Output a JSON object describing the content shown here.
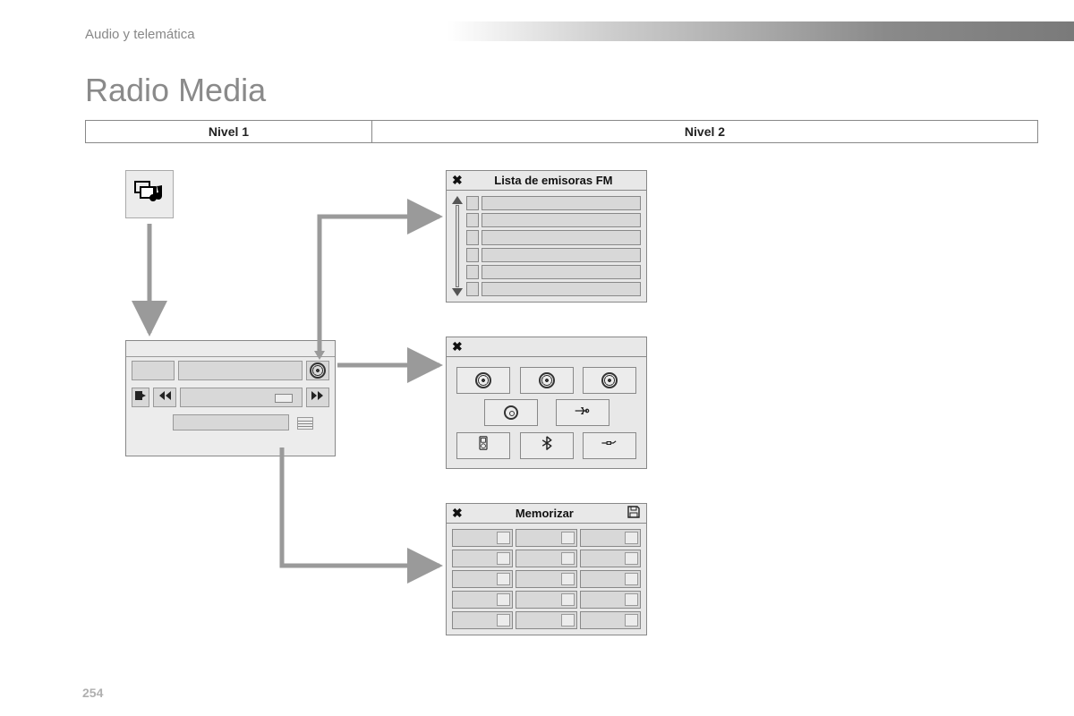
{
  "breadcrumb": "Audio y telemática",
  "title": "Radio Media",
  "page_number": "254",
  "levels": {
    "col1": "Nivel 1",
    "col2": "Nivel 2"
  },
  "icons": {
    "app": "music-app-icon",
    "radio": "radio-icon",
    "disc": "disc-icon",
    "usb": "usb-icon",
    "ipod": "ipod-icon",
    "bluetooth": "bluetooth-icon",
    "aux": "aux-jack-icon",
    "save": "save-icon",
    "close": "✖",
    "prev": "prev-track-icon",
    "next": "next-track-icon",
    "exit": "exit-icon",
    "list": "list-icon"
  },
  "panels": {
    "fm": {
      "title": "Lista de emisoras FM",
      "rows": 6
    },
    "sources": {
      "title": "",
      "row1": [
        "radio",
        "radio",
        "radio"
      ],
      "row2": [
        "disc",
        "usb"
      ],
      "row3": [
        "ipod",
        "bluetooth",
        "aux"
      ]
    },
    "memorize": {
      "title": "Memorizar",
      "cols": 3,
      "rows": 5
    },
    "player": {}
  }
}
